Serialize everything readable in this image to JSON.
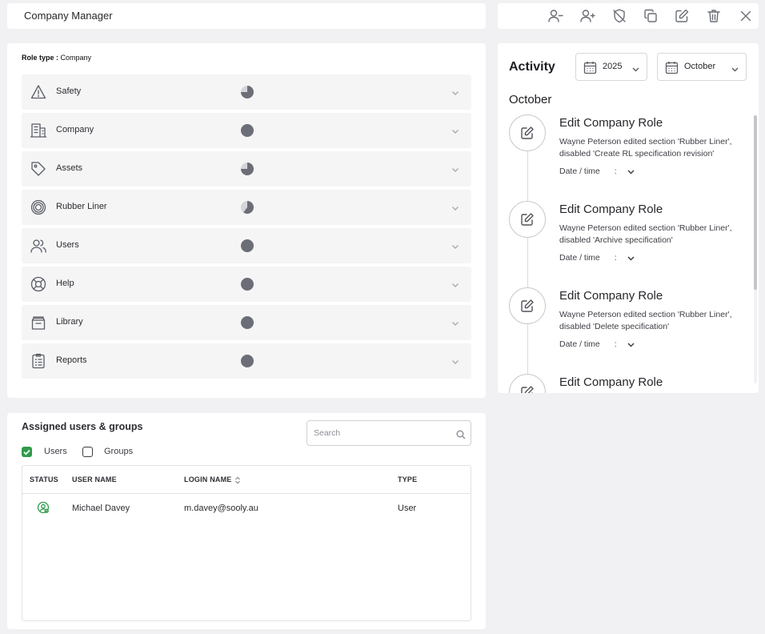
{
  "header": {
    "title": "Company Manager"
  },
  "toolbar": {
    "buttons": [
      {
        "name": "remove-user-icon"
      },
      {
        "name": "add-user-icon"
      },
      {
        "name": "shield-off-icon"
      },
      {
        "name": "copy-icon"
      },
      {
        "name": "edit-icon"
      },
      {
        "name": "trash-icon"
      },
      {
        "name": "close-icon"
      }
    ]
  },
  "role": {
    "type_label": "Role type :",
    "type_value": "Company",
    "permissions": [
      {
        "label": "Safety",
        "icon": "warning-icon",
        "fill": 0.75
      },
      {
        "label": "Company",
        "icon": "building-icon",
        "fill": 1
      },
      {
        "label": "Assets",
        "icon": "tag-icon",
        "fill": 0.75
      },
      {
        "label": "Rubber Liner",
        "icon": "rings-icon",
        "fill": 0.6
      },
      {
        "label": "Users",
        "icon": "users-icon",
        "fill": 1
      },
      {
        "label": "Help",
        "icon": "lifebuoy-icon",
        "fill": 1
      },
      {
        "label": "Library",
        "icon": "library-icon",
        "fill": 1
      },
      {
        "label": "Reports",
        "icon": "clipboard-icon",
        "fill": 1
      }
    ],
    "pie_color": "#6b6e76",
    "pie_bg": "#d4d5d9"
  },
  "activity": {
    "title": "Activity",
    "year": "2025",
    "month": "October",
    "month_heading": "October",
    "items": [
      {
        "title": "Edit Company Role",
        "description": "Wayne Peterson edited section 'Rubber Liner', disabled 'Create RL specification revision'",
        "date_label": "Date / time",
        "date_sep": ":"
      },
      {
        "title": "Edit Company Role",
        "description": "Wayne Peterson edited section 'Rubber Liner', disabled 'Archive specification'",
        "date_label": "Date / time",
        "date_sep": ":"
      },
      {
        "title": "Edit Company Role",
        "description": "Wayne Peterson edited section 'Rubber Liner', disabled 'Delete specification'",
        "date_label": "Date / time",
        "date_sep": ":"
      },
      {
        "title": "Edit Company Role",
        "description": "",
        "date_label": "",
        "date_sep": ""
      }
    ]
  },
  "assigned": {
    "title": "Assigned users & groups",
    "search_placeholder": "Search",
    "filters": [
      {
        "label": "Users",
        "checked": true
      },
      {
        "label": "Groups",
        "checked": false
      }
    ],
    "columns": [
      "STATUS",
      "USER NAME",
      "LOGIN NAME",
      "TYPE"
    ],
    "rows": [
      {
        "status": "active-user-icon",
        "user_name": "Michael Davey",
        "login_name": "m.davey@sooly.au",
        "type": "User"
      }
    ],
    "accent": "#2f9a4b"
  }
}
